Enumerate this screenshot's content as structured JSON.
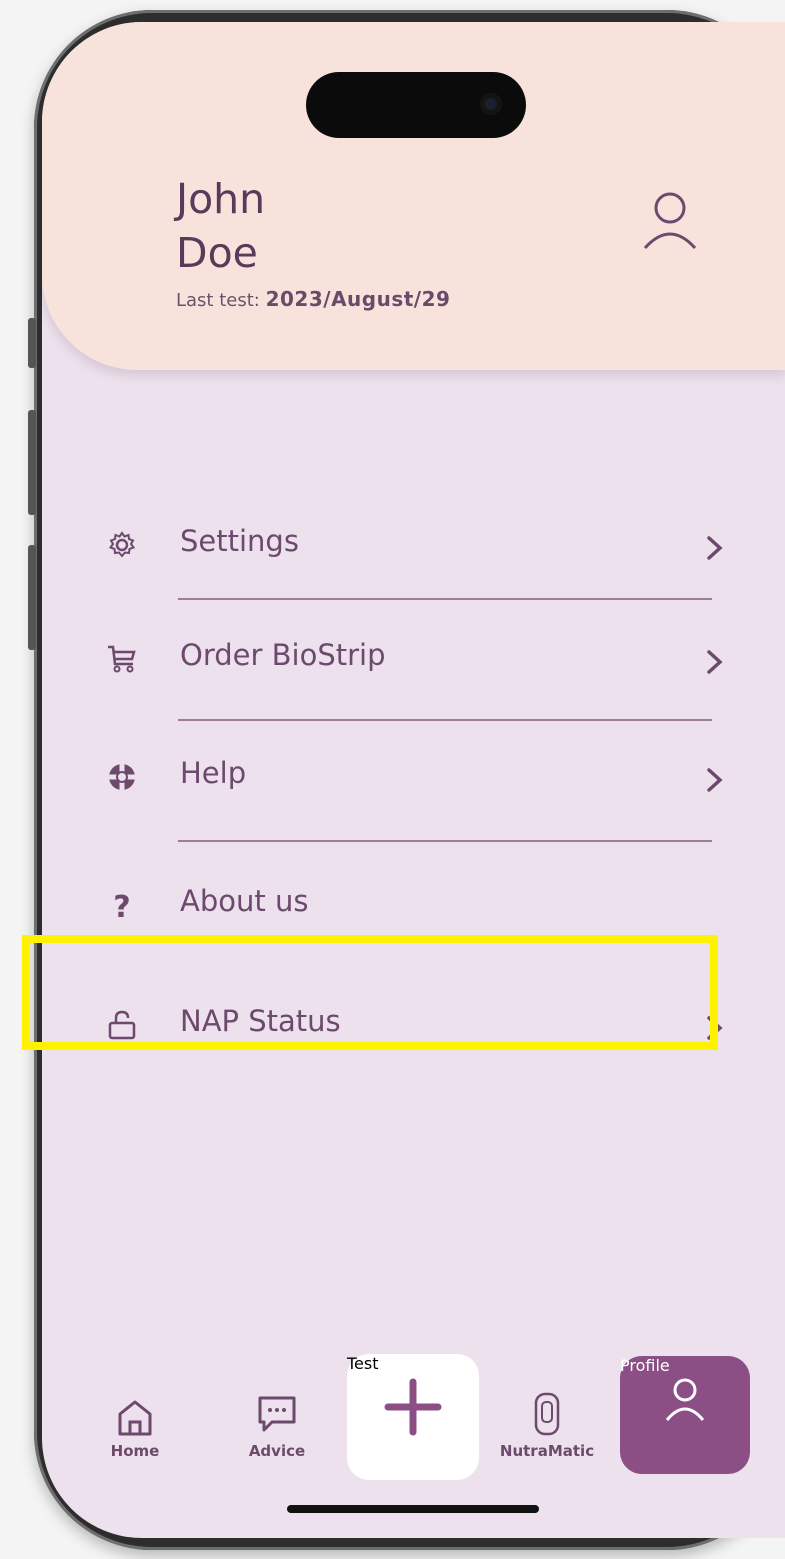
{
  "user": {
    "first_name": "John",
    "last_name": "Doe",
    "last_test_label": "Last test:",
    "last_test_date": "2023/August/29"
  },
  "menu": [
    {
      "label": "Settings",
      "icon": "gear-icon"
    },
    {
      "label": "Order BioStrip",
      "icon": "cart-icon"
    },
    {
      "label": "Help",
      "icon": "lifebuoy-icon"
    },
    {
      "label": "About us",
      "icon": "question-icon"
    },
    {
      "label": "NAP Status",
      "icon": "unlock-icon"
    }
  ],
  "nav": {
    "home": "Home",
    "advice": "Advice",
    "test": "Test",
    "nutramatic": "NutraMatic",
    "profile": "Profile",
    "active": "Profile"
  },
  "colors": {
    "accent": "#8b4f86",
    "header_bg": "#f7e3dc",
    "screen_bg": "#ece1ec",
    "highlight": "#fff200"
  }
}
